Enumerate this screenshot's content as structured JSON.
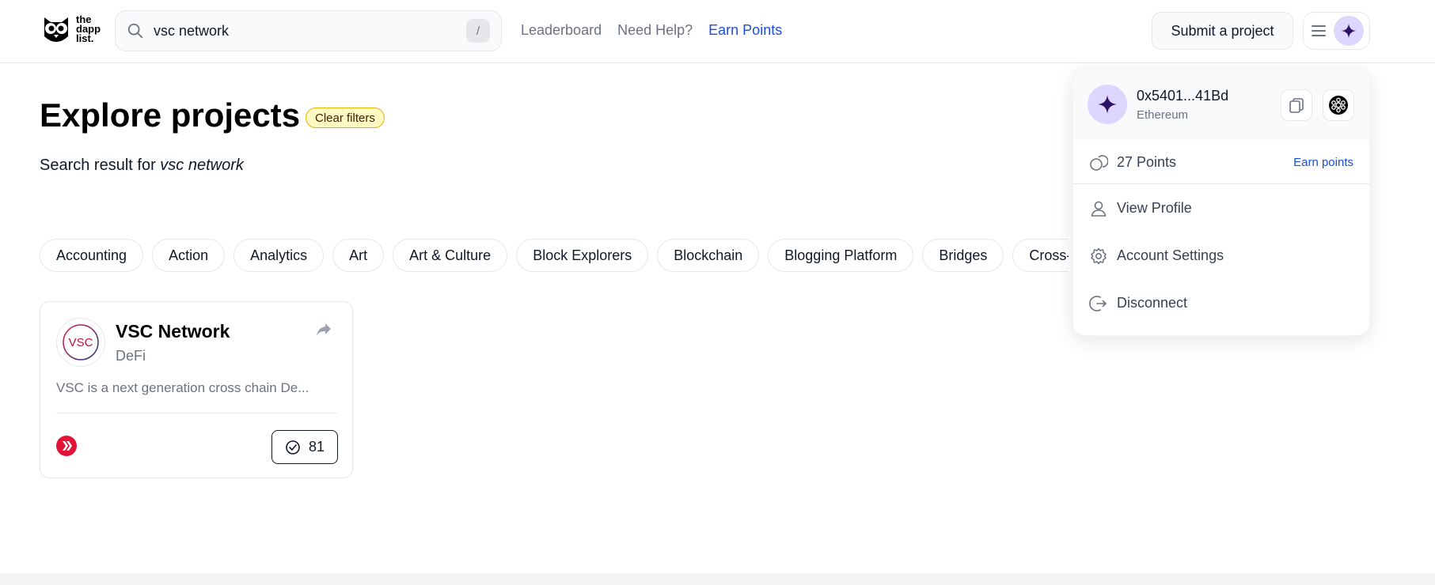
{
  "header": {
    "logo_text": [
      "the",
      "dapp",
      "list."
    ],
    "search": {
      "value": "vsc network",
      "shortcut": "/"
    },
    "nav": [
      {
        "label": "Leaderboard"
      },
      {
        "label": "Need Help?"
      },
      {
        "label": "Earn Points"
      }
    ],
    "submit_label": "Submit a project"
  },
  "main": {
    "title": "Explore projects",
    "clear_filters_label": "Clear filters",
    "search_result_prefix": "Search result for ",
    "search_result_query": "vsc network",
    "categories": [
      "Accounting",
      "Action",
      "Analytics",
      "Art",
      "Art & Culture",
      "Block Explorers",
      "Blockchain",
      "Blogging Platform",
      "Bridges",
      "Cross-chain"
    ]
  },
  "card": {
    "logo_text": "VSC",
    "name": "VSC Network",
    "category": "DeFi",
    "description": "VSC is a next generation cross chain De...",
    "votes": "81"
  },
  "wallet_menu": {
    "address": "0x5401...41Bd",
    "network": "Ethereum",
    "points_label": "27 Points",
    "earn_label": "Earn points",
    "items": [
      {
        "label": "View Profile",
        "icon": "user-icon"
      },
      {
        "label": "Account Settings",
        "icon": "gear-icon"
      },
      {
        "label": "Disconnect",
        "icon": "logout-icon"
      }
    ]
  },
  "colors": {
    "accent": "#1d4ed8",
    "avatar_bg": "#ddd6fe",
    "avatar_star": "#2e1065",
    "badge_bg": "#fef9c3",
    "badge_border": "#eab308",
    "hive_red": "#e31337"
  }
}
